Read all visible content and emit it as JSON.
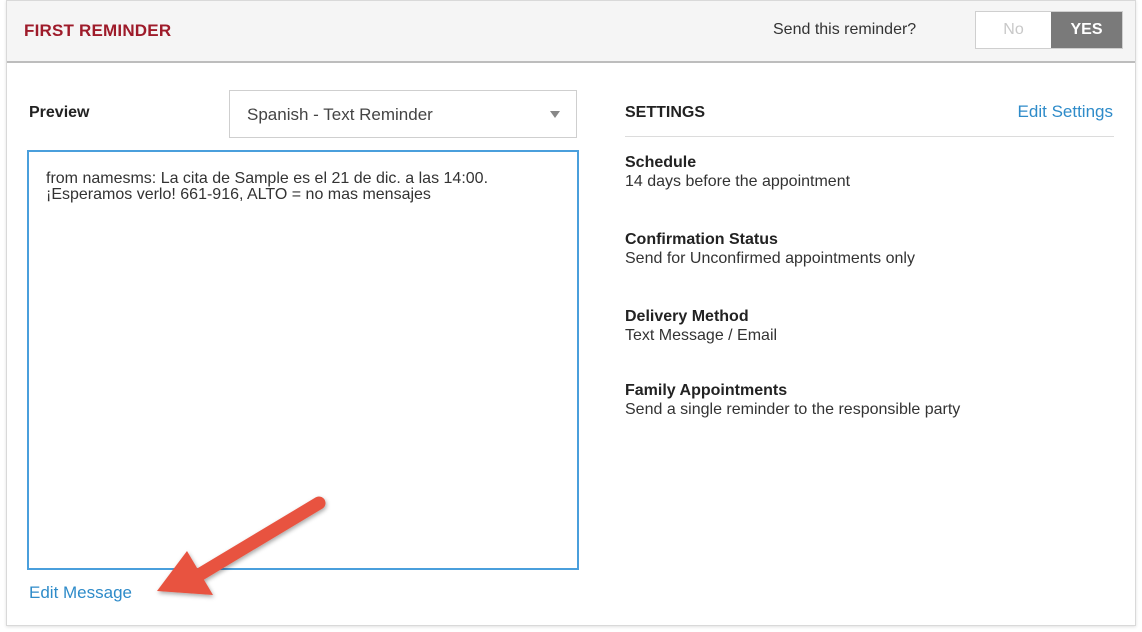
{
  "header": {
    "title": "FIRST REMINDER",
    "send_question": "Send this reminder?",
    "toggle": {
      "no_label": "No",
      "yes_label": "YES",
      "selected": "YES"
    }
  },
  "preview": {
    "label": "Preview",
    "template_select": {
      "value": "Spanish - Text Reminder"
    },
    "message": "from namesms: La cita de Sample es el 21 de dic. a las 14:00. ¡Esperamos verlo! 661-916, ALTO = no mas mensajes",
    "edit_link": "Edit Message"
  },
  "settings": {
    "title": "SETTINGS",
    "edit_link": "Edit Settings",
    "items": [
      {
        "name": "Schedule",
        "value": "14 days before the appointment"
      },
      {
        "name": "Confirmation Status",
        "value": "Send for Unconfirmed appointments only"
      },
      {
        "name": "Delivery Method",
        "value": "Text Message / Email"
      },
      {
        "name": "Family Appointments",
        "value": "Send a single reminder to the responsible party"
      }
    ]
  },
  "colors": {
    "title_red": "#9e1b2a",
    "link_blue": "#2e8bc9",
    "focus_blue": "#4a9fdc",
    "toggle_active": "#7a7a7a",
    "annotation_arrow": "#e8533f"
  },
  "icons": {
    "select_caret": "chevron-down-icon",
    "annotation": "arrow-annotation-icon"
  }
}
